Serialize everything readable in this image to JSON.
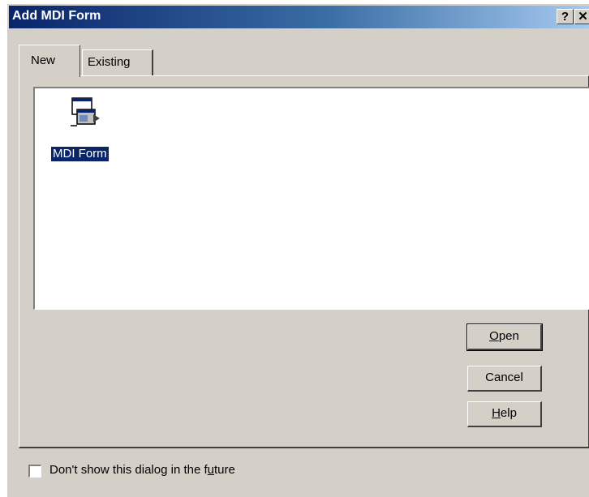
{
  "window": {
    "title": "Add MDI Form",
    "help_glyph": "?",
    "close_glyph": "✕"
  },
  "tabs": [
    {
      "label": "New",
      "active": true
    },
    {
      "label": "Existing",
      "active": false
    }
  ],
  "list": {
    "items": [
      {
        "label": "MDI Form",
        "icon": "mdi-form-icon",
        "selected": true
      }
    ]
  },
  "buttons": {
    "open": {
      "mnemonic": "O",
      "rest": "pen"
    },
    "cancel": {
      "label": "Cancel"
    },
    "help": {
      "mnemonic": "H",
      "rest": "elp"
    }
  },
  "checkbox": {
    "label_pre": "Don't show this dialog in the f",
    "label_mnemonic": "u",
    "label_post": "ture",
    "checked": false
  },
  "colors": {
    "titlebar_start": "#0a246a",
    "titlebar_end": "#a6caf0",
    "face": "#d4d0c8",
    "selection": "#0a246a"
  }
}
